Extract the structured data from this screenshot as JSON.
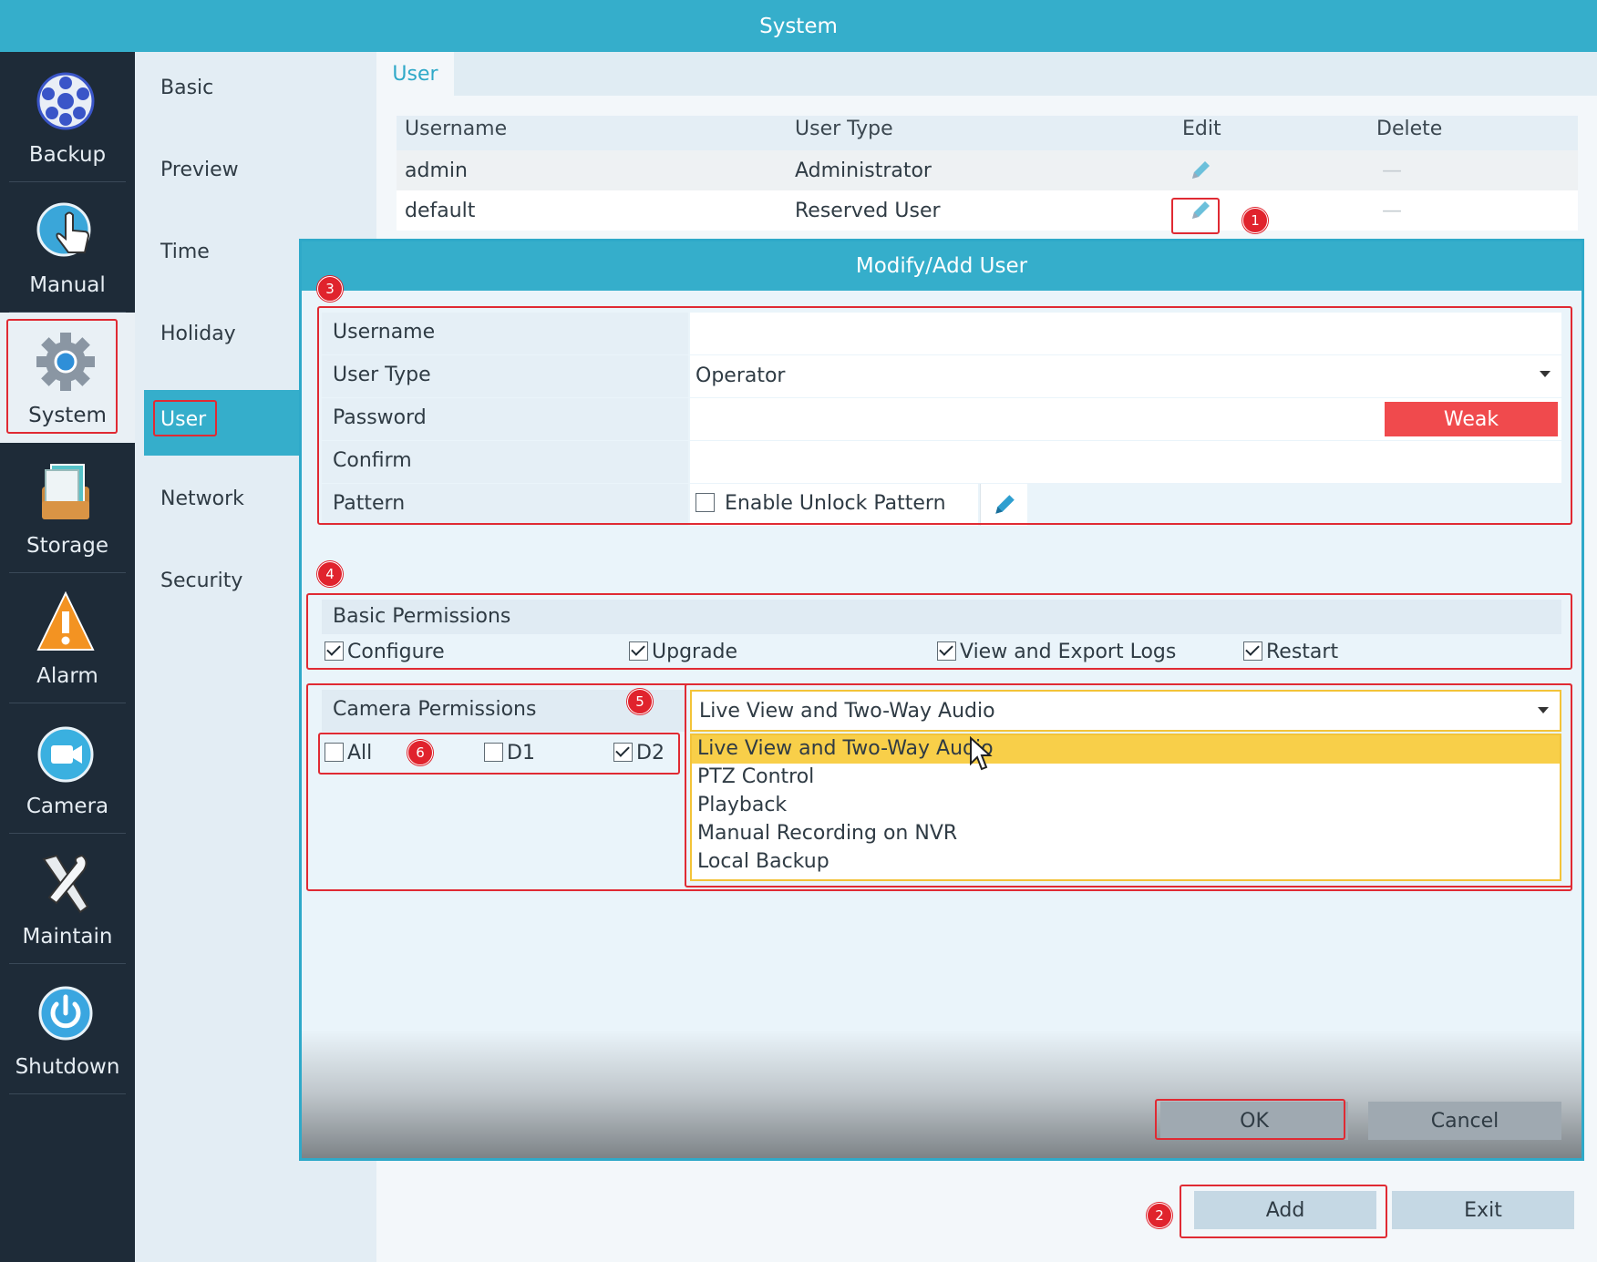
{
  "window": {
    "title": "System"
  },
  "left_nav": {
    "items": [
      {
        "label": "Backup",
        "icon": "film-reel-icon"
      },
      {
        "label": "Manual",
        "icon": "hand-pointer-icon"
      },
      {
        "label": "System",
        "icon": "gear-icon",
        "active": true
      },
      {
        "label": "Storage",
        "icon": "storage-icon"
      },
      {
        "label": "Alarm",
        "icon": "warning-icon"
      },
      {
        "label": "Camera",
        "icon": "camera-icon"
      },
      {
        "label": "Maintain",
        "icon": "tools-icon"
      },
      {
        "label": "Shutdown",
        "icon": "power-icon"
      }
    ]
  },
  "sub_nav": {
    "items": [
      "Basic",
      "Preview",
      "Time",
      "Holiday",
      "User",
      "Network",
      "Security"
    ],
    "active": "User"
  },
  "main": {
    "tab": "User",
    "table": {
      "headers": [
        "Username",
        "User Type",
        "Edit",
        "Delete"
      ],
      "rows": [
        {
          "username": "admin",
          "user_type": "Administrator",
          "delete": "—"
        },
        {
          "username": "default",
          "user_type": "Reserved User",
          "delete": "—"
        }
      ]
    },
    "buttons": {
      "add": "Add",
      "exit": "Exit"
    }
  },
  "dialog": {
    "title": "Modify/Add User",
    "fields": {
      "username_label": "Username",
      "username_value": "",
      "user_type_label": "User Type",
      "user_type_value": "Operator",
      "password_label": "Password",
      "password_strength": "Weak",
      "confirm_label": "Confirm",
      "pattern_label": "Pattern",
      "pattern_checkbox": "Enable Unlock Pattern"
    },
    "basic_permissions": {
      "title": "Basic Permissions",
      "items": [
        {
          "label": "Configure",
          "checked": true
        },
        {
          "label": "Upgrade",
          "checked": true
        },
        {
          "label": "View and Export Logs",
          "checked": true
        },
        {
          "label": "Restart",
          "checked": true
        }
      ]
    },
    "camera_permissions": {
      "title": "Camera Permissions",
      "selected": "Live View and Two-Way Audio",
      "options": [
        "Live View and Two-Way Audio",
        "PTZ Control",
        "Playback",
        "Manual Recording on NVR",
        "Local Backup"
      ],
      "channels": [
        {
          "label": "All",
          "checked": false
        },
        {
          "label": "D1",
          "checked": false
        },
        {
          "label": "D2",
          "checked": true
        }
      ]
    },
    "buttons": {
      "ok": "OK",
      "cancel": "Cancel"
    }
  },
  "annotations": {
    "b1": "1",
    "b2": "2",
    "b3": "3",
    "b4": "4",
    "b5": "5",
    "b6": "6"
  },
  "colors": {
    "accent": "#35aecb",
    "nav_dark": "#1e2b38",
    "highlight": "#f8cf49",
    "annotation_red": "#e02a33",
    "weak_red": "#f04a4d"
  }
}
